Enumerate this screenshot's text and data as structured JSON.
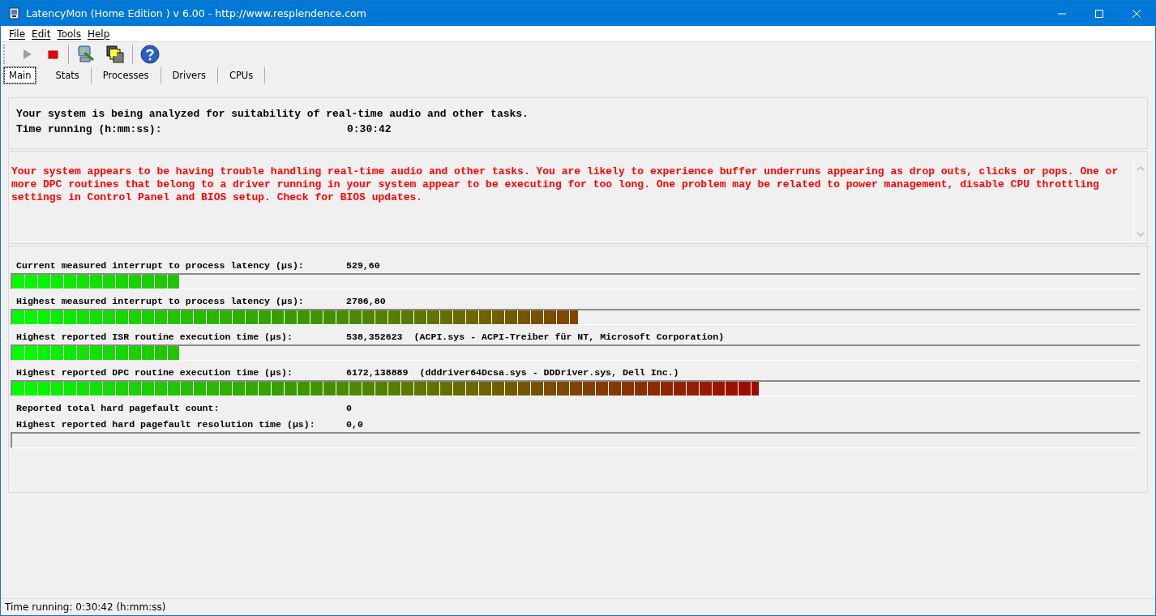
{
  "window": {
    "title": "LatencyMon  (Home Edition )  v 6.00 - http://www.resplendence.com"
  },
  "menu": [
    "File",
    "Edit",
    "Tools",
    "Help"
  ],
  "tabs": [
    {
      "label": "Main",
      "selected": true
    },
    {
      "label": "Stats",
      "selected": false
    },
    {
      "label": "Processes",
      "selected": false
    },
    {
      "label": "Drivers",
      "selected": false
    },
    {
      "label": "CPUs",
      "selected": false
    }
  ],
  "status_panel": {
    "message": "Your system is being analyzed for suitability of real-time audio and other tasks.",
    "time_label": "Time running (h:mm:ss):",
    "time_value": "0:30:42"
  },
  "verdict": "Your system appears to be having trouble handling real-time audio and other tasks. You are likely to experience buffer underruns appearing as drop outs, clicks or pops. One or more DPC routines that belong to a driver running in your system appear to be executing for too long. One problem may be related to power management, disable CPU throttling settings in Control Panel and BIOS setup. Check for BIOS updates.",
  "metrics": [
    {
      "kind": "bar",
      "label": "Current measured interrupt to process latency (µs):",
      "value": "529,60",
      "level": 0.148
    },
    {
      "kind": "bar",
      "label": "Highest measured interrupt to process latency (µs):",
      "value": "2786,80",
      "level": 0.502
    },
    {
      "kind": "bar",
      "label": "Highest reported ISR routine execution time (µs):",
      "value": "538,352623",
      "detail": "(ACPI.sys - ACPI-Treiber für NT, Microsoft Corporation)",
      "level": 0.148
    },
    {
      "kind": "bar",
      "label": "Highest reported DPC routine execution time (µs):",
      "value": "6172,138889",
      "detail": "(dddriver64Dcsa.sys - DDDriver.sys, Dell Inc.)",
      "level": 0.662
    },
    {
      "kind": "text",
      "label": "Reported total hard pagefault count:",
      "value": "0"
    },
    {
      "kind": "bar",
      "label": "Highest reported hard pagefault resolution time (µs):",
      "value": "0,0"
    }
  ],
  "status_bar": "Time running: 0:30:42  (h:mm:ss)"
}
